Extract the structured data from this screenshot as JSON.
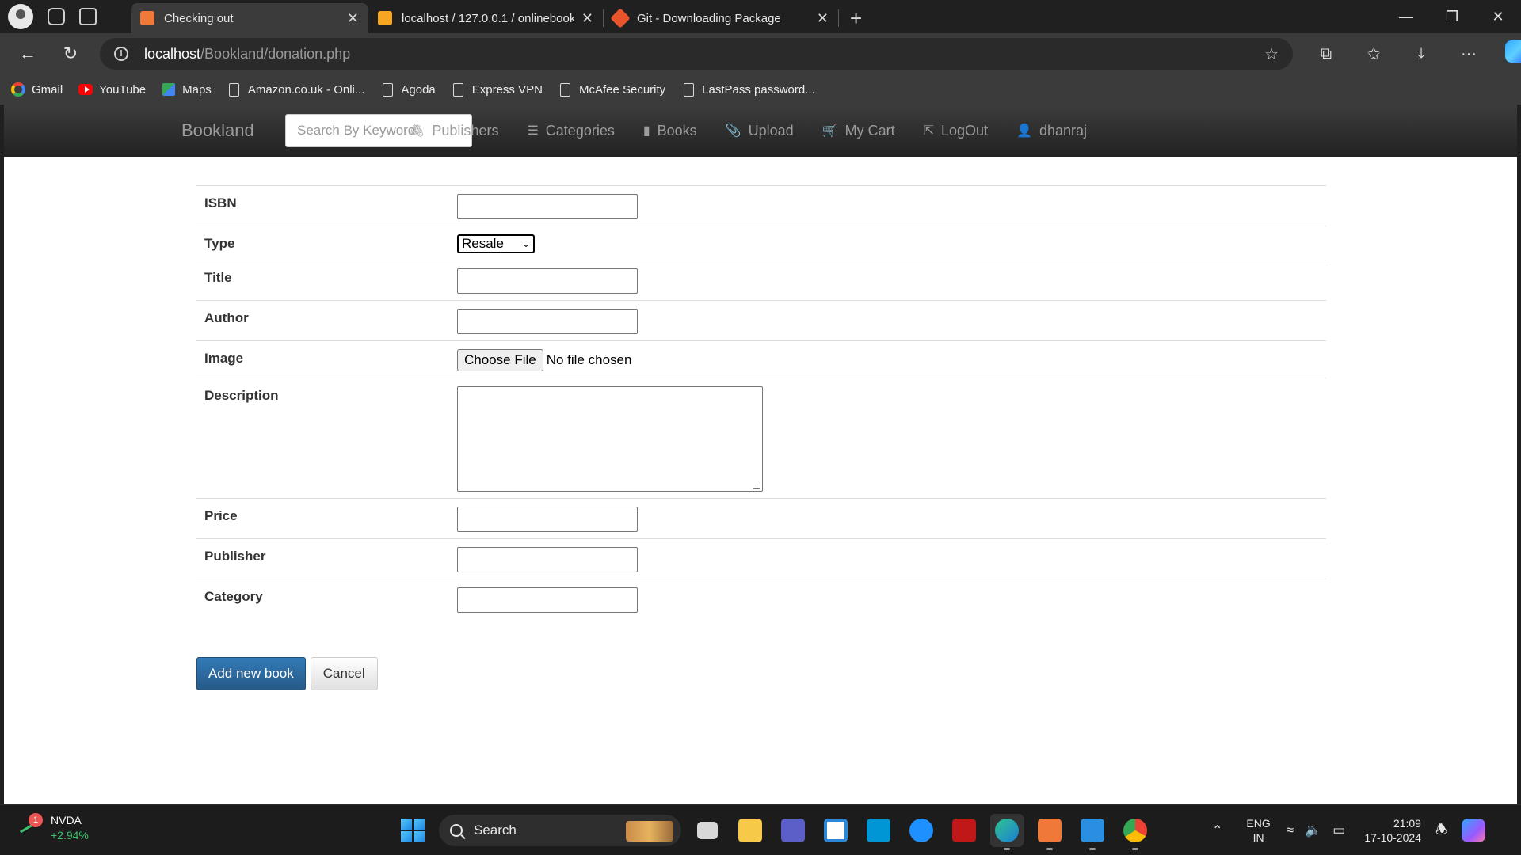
{
  "browser": {
    "tabs": [
      {
        "title": "Checking out",
        "favicon_color": "#f0793a",
        "active": true
      },
      {
        "title": "localhost / 127.0.0.1 / onlinebook",
        "favicon_color": "#f5a623",
        "active": false
      },
      {
        "title": "Git - Downloading Package",
        "favicon_color": "#e8552d",
        "active": false
      }
    ],
    "address": {
      "host": "localhost",
      "path": "/Bookland/donation.php"
    },
    "bookmarks": [
      {
        "label": "Gmail",
        "icon": "google-icon"
      },
      {
        "label": "YouTube",
        "icon": "youtube-icon"
      },
      {
        "label": "Maps",
        "icon": "maps-icon"
      },
      {
        "label": "Amazon.co.uk - Onli...",
        "icon": "page-icon"
      },
      {
        "label": "Agoda",
        "icon": "page-icon"
      },
      {
        "label": "Express VPN",
        "icon": "page-icon"
      },
      {
        "label": "McAfee Security",
        "icon": "page-icon"
      },
      {
        "label": "LastPass password...",
        "icon": "page-icon"
      }
    ]
  },
  "site": {
    "brand": "Bookland",
    "search_placeholder": "Search By Keyword",
    "nav": [
      {
        "label": "Publishers",
        "icon": "paperclip-icon",
        "glyph": "🖇"
      },
      {
        "label": "Categories",
        "icon": "list-icon",
        "glyph": "☰"
      },
      {
        "label": "Books",
        "icon": "book-icon",
        "glyph": "▮"
      },
      {
        "label": "Upload",
        "icon": "paperclip-icon",
        "glyph": "📎"
      },
      {
        "label": "My Cart",
        "icon": "cart-icon",
        "glyph": "🛒"
      },
      {
        "label": "LogOut",
        "icon": "logout-icon",
        "glyph": "⇱"
      },
      {
        "label": "dhanraj",
        "icon": "user-icon",
        "glyph": "👤"
      }
    ]
  },
  "form": {
    "isbn_label": "ISBN",
    "type_label": "Type",
    "type_selected": "Resale",
    "title_label": "Title",
    "author_label": "Author",
    "image_label": "Image",
    "file_button": "Choose File",
    "file_status": "No file chosen",
    "description_label": "Description",
    "price_label": "Price",
    "publisher_label": "Publisher",
    "category_label": "Category",
    "submit_label": "Add new book",
    "cancel_label": "Cancel"
  },
  "taskbar": {
    "stock_symbol": "NVDA",
    "stock_change": "+2.94%",
    "stock_badge": "1",
    "search_label": "Search",
    "lang_line1": "ENG",
    "lang_line2": "IN",
    "time": "21:09",
    "date": "17-10-2024"
  }
}
